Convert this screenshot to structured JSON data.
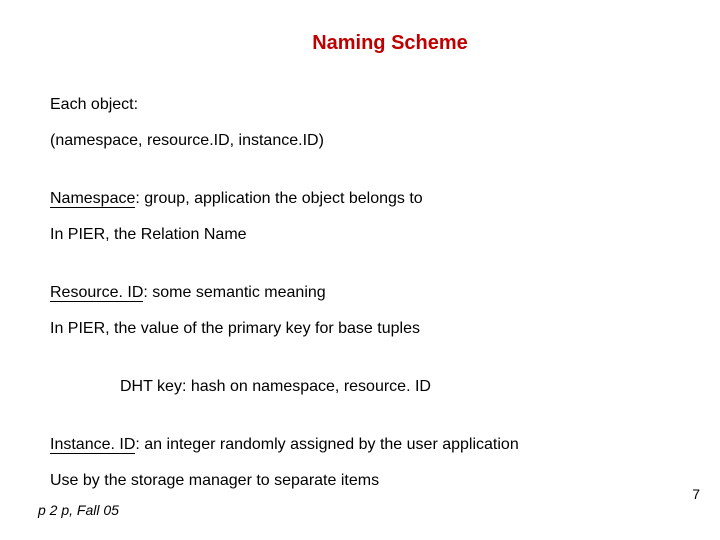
{
  "title": "Naming Scheme",
  "body": {
    "each_object_label": "Each object:",
    "tuple_format": "(namespace, resource.ID, instance.ID)",
    "namespace_term": "Namespace",
    "namespace_desc": ": group, application the object belongs to",
    "namespace_pier": "In PIER, the Relation Name",
    "resource_term": "Resource. ID",
    "resource_desc": ": some semantic meaning",
    "resource_pier": "In PIER, the value of the primary key for base tuples",
    "dht_key": "DHT key: hash on namespace, resource. ID",
    "instance_term": "Instance. ID",
    "instance_desc": ": an integer randomly assigned by the user application",
    "instance_usage": "Use by the storage manager to separate items"
  },
  "footer": "p 2 p, Fall 05",
  "page_number": "7"
}
